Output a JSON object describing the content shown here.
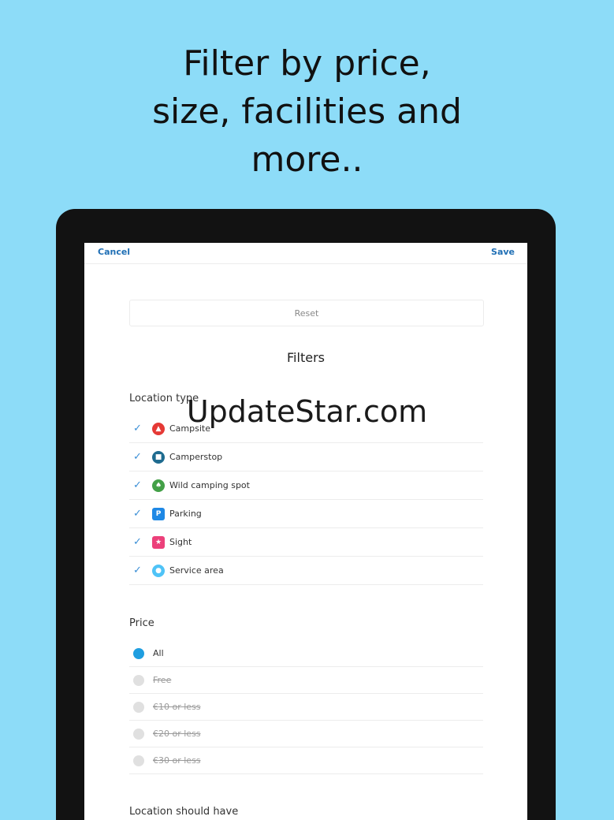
{
  "headline": {
    "line1": "Filter by price,",
    "line2": "size, facilities and",
    "line3": "more.."
  },
  "navbar": {
    "cancel_label": "Cancel",
    "save_label": "Save"
  },
  "reset_label": "Reset",
  "filters_title": "Filters",
  "location_type": {
    "label": "Location type",
    "items": [
      {
        "label": "Campsite",
        "checked": true,
        "icon": "campsite-icon",
        "color": "#e53935"
      },
      {
        "label": "Camperstop",
        "checked": true,
        "icon": "camper-icon",
        "color": "#1e6b8f"
      },
      {
        "label": "Wild camping spot",
        "checked": true,
        "icon": "tree-icon",
        "color": "#43a047"
      },
      {
        "label": "Parking",
        "checked": true,
        "icon": "parking-icon",
        "color": "#1e88e5"
      },
      {
        "label": "Sight",
        "checked": true,
        "icon": "star-icon",
        "color": "#ec407a"
      },
      {
        "label": "Service area",
        "checked": true,
        "icon": "water-drop-icon",
        "color": "#4fc3f7"
      }
    ]
  },
  "price": {
    "label": "Price",
    "options": [
      {
        "label": "All",
        "selected": true,
        "disabled": false
      },
      {
        "label": "Free",
        "selected": false,
        "disabled": true
      },
      {
        "label": "€10 or less",
        "selected": false,
        "disabled": true
      },
      {
        "label": "€20 or less",
        "selected": false,
        "disabled": true
      },
      {
        "label": "€30 or less",
        "selected": false,
        "disabled": true
      }
    ]
  },
  "location_should_have_label": "Location should have",
  "watermark": "UpdateStar.com",
  "colors": {
    "background": "#8ddcf8",
    "accent": "#1f6fb5",
    "radio_selected": "#1f9ee0"
  }
}
